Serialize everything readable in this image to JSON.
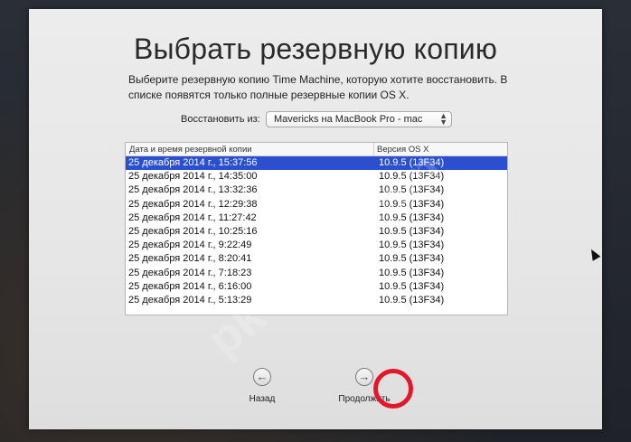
{
  "window": {
    "title": "Выбрать резервную копию",
    "subtitle": "Выберите резервную копию Time Machine, которую хотите восстановить. В списке появятся только полные резервные копии OS X."
  },
  "restore": {
    "label": "Восстановить из:",
    "selected": "Mavericks на MacBook Pro - mac"
  },
  "table": {
    "columns": [
      "Дата и время резервной копии",
      "Версия OS X"
    ],
    "rows": [
      {
        "date": "25 декабря 2014 г., 15:37:56",
        "version": "10.9.5 (13F34)",
        "selected": true
      },
      {
        "date": "25 декабря 2014 г., 14:35:00",
        "version": "10.9.5 (13F34)"
      },
      {
        "date": "25 декабря 2014 г., 13:32:36",
        "version": "10.9.5 (13F34)"
      },
      {
        "date": "25 декабря 2014 г., 12:29:38",
        "version": "10.9.5 (13F34)"
      },
      {
        "date": "25 декабря 2014 г., 11:27:42",
        "version": "10.9.5 (13F34)"
      },
      {
        "date": "25 декабря 2014 г., 10:25:16",
        "version": "10.9.5 (13F34)"
      },
      {
        "date": "25 декабря 2014 г., 9:22:49",
        "version": "10.9.5 (13F34)"
      },
      {
        "date": "25 декабря 2014 г., 8:20:41",
        "version": "10.9.5 (13F34)"
      },
      {
        "date": "25 декабря 2014 г., 7:18:23",
        "version": "10.9.5 (13F34)"
      },
      {
        "date": "25 декабря 2014 г., 6:16:00",
        "version": "10.9.5 (13F34)"
      },
      {
        "date": "25 декабря 2014 г., 5:13:29",
        "version": "10.9.5 (13F34)"
      }
    ]
  },
  "nav": {
    "back_label": "Назад",
    "back_icon": "←",
    "continue_label": "Продолжить",
    "continue_icon": "→"
  },
  "watermark": {
    "text": "pk-help.com"
  },
  "colors": {
    "selection": "#2c4fd0",
    "highlight_ring": "#e2182a"
  }
}
